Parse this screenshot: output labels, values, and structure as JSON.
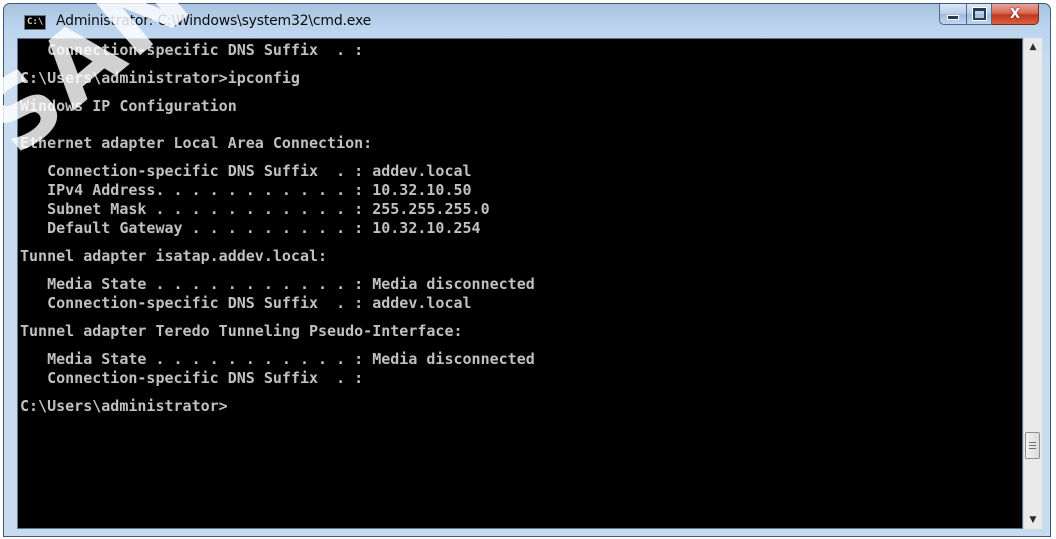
{
  "window": {
    "title": "Administrator: C:\\Windows\\system32\\cmd.exe",
    "icon_label": "C:\\",
    "controls": {
      "minimize": "minimize-icon",
      "maximize": "maximize-icon",
      "close_glyph": "X"
    }
  },
  "watermark": {
    "text": "SANS Instit"
  },
  "console": {
    "lines": [
      "   Connection-specific DNS Suffix  . :",
      "",
      "C:\\Users\\administrator>ipconfig",
      "",
      "Windows IP Configuration",
      "",
      "",
      "Ethernet adapter Local Area Connection:",
      "",
      "   Connection-specific DNS Suffix  . : addev.local",
      "   IPv4 Address. . . . . . . . . . . : 10.32.10.50",
      "   Subnet Mask . . . . . . . . . . . : 255.255.255.0",
      "   Default Gateway . . . . . . . . . : 10.32.10.254",
      "",
      "Tunnel adapter isatap.addev.local:",
      "",
      "   Media State . . . . . . . . . . . : Media disconnected",
      "   Connection-specific DNS Suffix  . : addev.local",
      "",
      "Tunnel adapter Teredo Tunneling Pseudo-Interface:",
      "",
      "   Media State . . . . . . . . . . . : Media disconnected",
      "   Connection-specific DNS Suffix  . :",
      "",
      "C:\\Users\\administrator>"
    ],
    "colors": {
      "background": "#000000",
      "text": "#c0c0c0"
    }
  },
  "scrollbar": {
    "up_icon": "scroll-up-icon",
    "down_icon": "scroll-down-icon"
  }
}
